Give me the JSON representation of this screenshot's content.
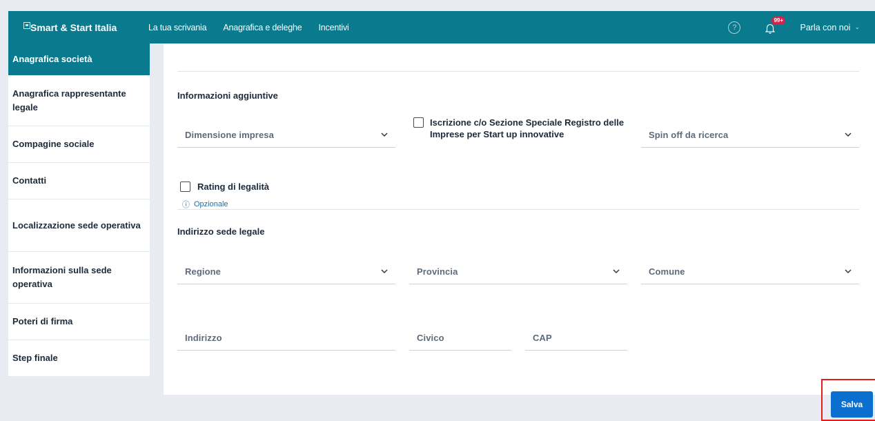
{
  "header": {
    "brand": "Smart & Start Italia",
    "nav": [
      "La tua scrivania",
      "Anagrafica e deleghe",
      "Incentivi"
    ],
    "help_icon": "?",
    "notification_badge": "99+",
    "talk_label": "Parla con noi",
    "bg_color": "#0a7a8f"
  },
  "sidebar": {
    "items": [
      {
        "label": "Anagrafica società",
        "active": true
      },
      {
        "label": "Anagrafica rappresentante legale",
        "active": false
      },
      {
        "label": "Compagine sociale",
        "active": false
      },
      {
        "label": "Contatti",
        "active": false
      },
      {
        "label": "Localizzazione sede operativa",
        "active": false
      },
      {
        "label": "Informazioni sulla sede operativa",
        "active": false
      },
      {
        "label": "Poteri di firma",
        "active": false
      },
      {
        "label": "Step finale",
        "active": false
      }
    ]
  },
  "form": {
    "additional_info_title": "Informazioni aggiuntive",
    "company_size_placeholder": "Dimensione impresa",
    "registry_checkbox_label": "Iscrizione c/o Sezione Speciale Registro delle Imprese per Start up innovative",
    "spin_off_placeholder": "Spin off da ricerca",
    "rating_checkbox_label": "Rating di legalità",
    "optional_hint": "Opzionale",
    "legal_address_title": "Indirizzo sede legale",
    "region_placeholder": "Regione",
    "province_placeholder": "Provincia",
    "municipality_placeholder": "Comune",
    "address_placeholder": "Indirizzo",
    "civic_placeholder": "Civico",
    "cap_placeholder": "CAP"
  },
  "actions": {
    "save_label": "Salva",
    "save_color": "#0b6fd0"
  }
}
